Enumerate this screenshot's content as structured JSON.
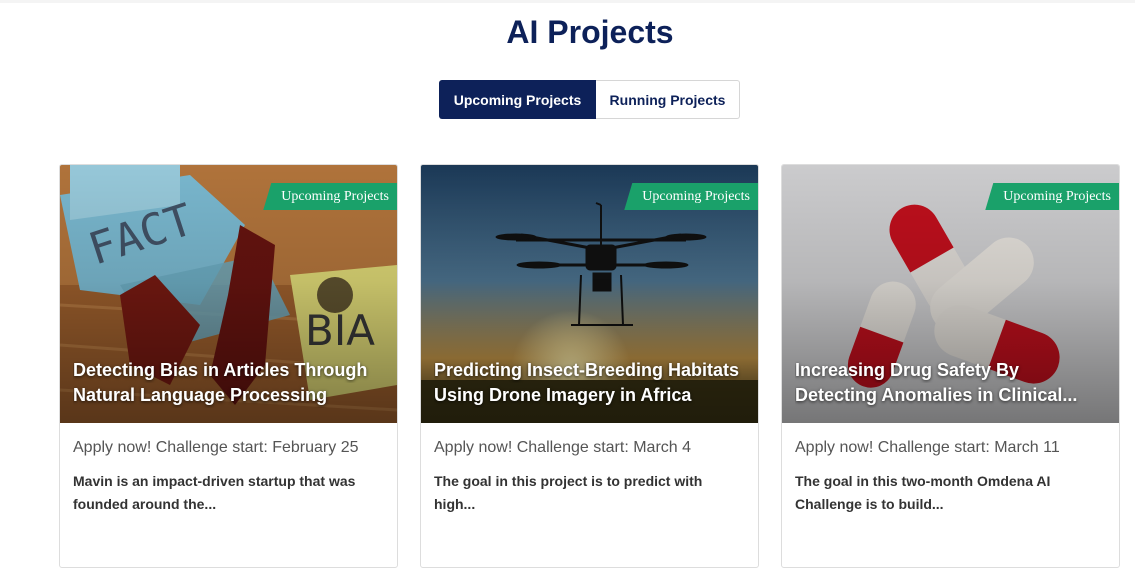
{
  "page": {
    "title": "AI Projects"
  },
  "tabs": [
    {
      "label": "Upcoming Projects",
      "active": true
    },
    {
      "label": "Running Projects",
      "active": false
    }
  ],
  "cards": [
    {
      "ribbon": "Upcoming Projects",
      "title_line1": "Detecting Bias in Articles Through",
      "title_line2": "Natural Language Processing",
      "date": "Apply now! Challenge start: February 25",
      "desc_line1": "Mavin is an impact-driven startup that was",
      "desc_line2": "founded around the...",
      "image": "fact-bias-notes"
    },
    {
      "ribbon": "Upcoming Projects",
      "title_line1": "Predicting Insect-Breeding Habitats",
      "title_line2": "Using Drone Imagery in Africa",
      "date": "Apply now! Challenge start: March 4",
      "desc_line1": "The goal in this project is to predict with",
      "desc_line2": "high...",
      "image": "drone-sunset"
    },
    {
      "ribbon": "Upcoming Projects",
      "title_line1": "Increasing Drug Safety By",
      "title_line2": "Detecting Anomalies in Clinical...",
      "date": "Apply now! Challenge start: March 11",
      "desc_line1": "The goal in this two-month Omdena AI",
      "desc_line2": "Challenge is to build...",
      "image": "red-white-capsules"
    }
  ],
  "colors": {
    "navy": "#0d2159",
    "ribbon_green": "#1aa16a"
  }
}
